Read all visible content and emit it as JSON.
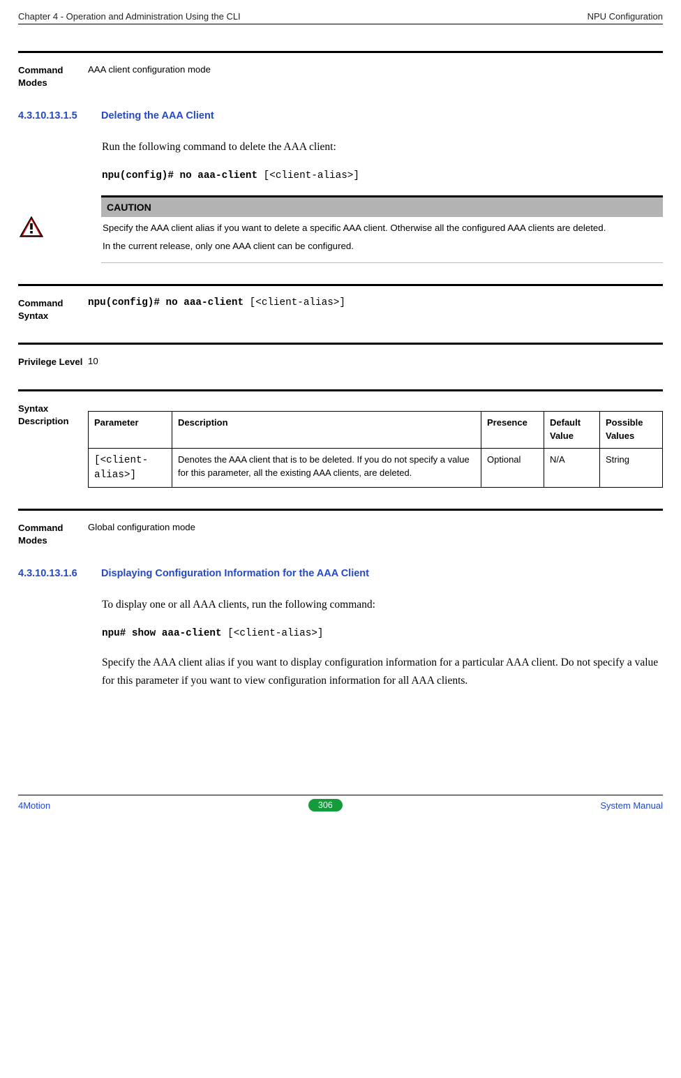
{
  "header": {
    "left": "Chapter 4 - Operation and Administration Using the CLI",
    "right": "NPU Configuration"
  },
  "block1": {
    "label": "Command Modes",
    "value": "AAA client configuration mode"
  },
  "sec5": {
    "num": "4.3.10.13.1.5",
    "title": "Deleting the AAA Client",
    "intro": "Run the following command to delete the AAA client:",
    "cmd_bold": "npu(config)# no aaa-client",
    "cmd_rest": " [<client-alias>]"
  },
  "caution": {
    "title": "CAUTION",
    "p1": "Specify the AAA client alias if you want to delete a specific AAA client. Otherwise all the configured AAA clients are deleted.",
    "p2": "In the current release, only one AAA client can be configured."
  },
  "block_syntax": {
    "label": "Command Syntax",
    "cmd_bold": "npu(config)# no aaa-client",
    "cmd_rest": " [<client-alias>]"
  },
  "block_priv": {
    "label": "Privilege Level",
    "value": "10"
  },
  "syntax_desc_label": "Syntax Description",
  "table": {
    "h1": "Parameter",
    "h2": "Description",
    "h3": "Presence",
    "h4": "Default Value",
    "h5": "Possible Values",
    "r1c1": "[<client-alias>]",
    "r1c2": "Denotes the AAA client that is to be deleted. If you do not specify a value for this parameter, all the existing AAA clients, are deleted.",
    "r1c3": "Optional",
    "r1c4": "N/A",
    "r1c5": "String"
  },
  "block_modes2": {
    "label": "Command Modes",
    "value": "Global configuration mode"
  },
  "sec6": {
    "num": "4.3.10.13.1.6",
    "title": "Displaying Configuration Information for the AAA Client",
    "intro": " To display one or all AAA clients, run the following command:",
    "cmd_bold": "npu# show aaa-client",
    "cmd_rest": " [<client-alias>]",
    "para": "Specify the AAA client alias if you want to display configuration information for a particular AAA client. Do not specify a value for this parameter if you want to view configuration information for all AAA clients."
  },
  "footer": {
    "left": "4Motion",
    "page": "306",
    "right": " System Manual"
  }
}
